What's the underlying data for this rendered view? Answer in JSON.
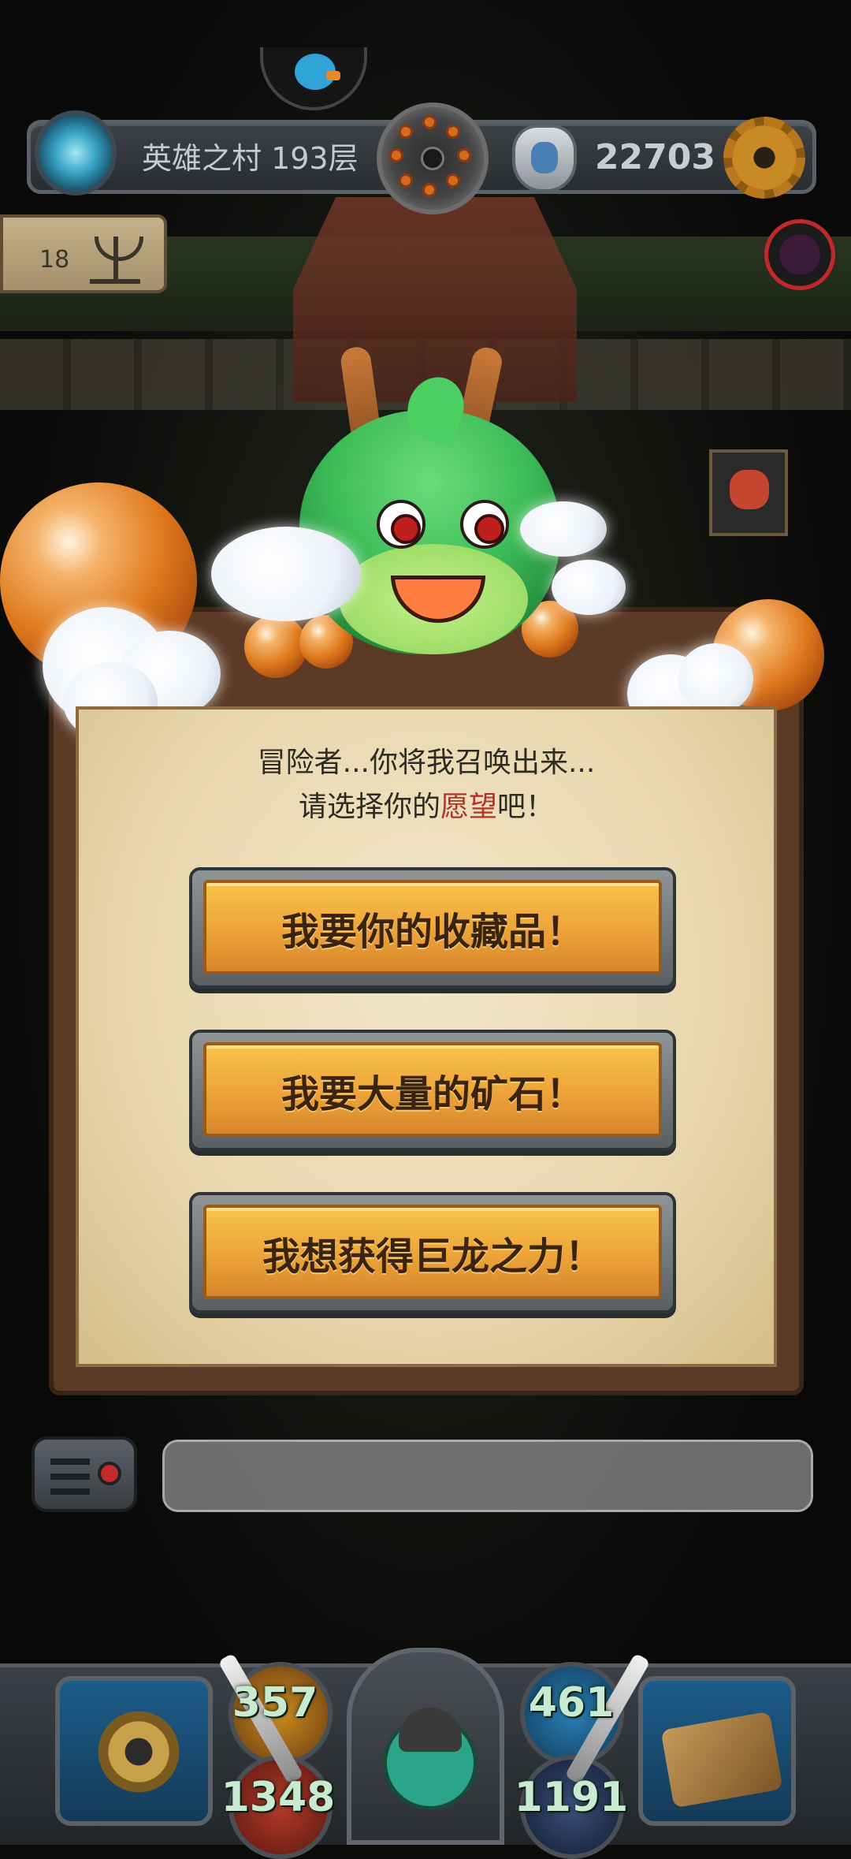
{
  "header": {
    "floor_label": "英雄之村 193层",
    "gold_count": "22703",
    "altar_count": "18"
  },
  "dialog": {
    "line1": "冒险者...你将我召唤出来...",
    "line2_prefix": "请选择你的",
    "line2_highlight": "愿望",
    "line2_suffix": "吧！",
    "highlight_color": "#b0332b"
  },
  "wishes": [
    {
      "label": "我要你的收藏品！"
    },
    {
      "label": "我要大量的矿石！"
    },
    {
      "label": "我想获得巨龙之力！"
    }
  ],
  "hud": {
    "attack": "357",
    "defense": "461",
    "hp": "1348",
    "mp": "1191"
  },
  "icons": {
    "top_left": "portal-icon",
    "top_center": "compass-icon",
    "currency": "shield-icon",
    "settings": "gear-icon",
    "altar": "candelabra-icon",
    "chat": "chat-menu-icon"
  },
  "colors": {
    "button_gold": "#eea63a",
    "panel_parchment": "#e8d7ae",
    "dragon_green": "#3ebd5a"
  }
}
